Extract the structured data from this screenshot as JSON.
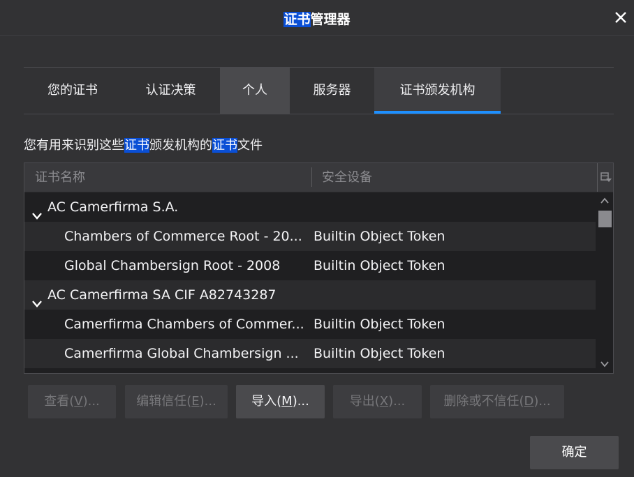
{
  "window": {
    "title_highlight": "证书",
    "title_rest": "管理器",
    "close_label": "×"
  },
  "tabs": [
    {
      "label": "您的证书",
      "selected": false
    },
    {
      "label": "认证决策",
      "selected": false
    },
    {
      "label": "个人",
      "selected": false
    },
    {
      "label": "服务器",
      "selected": false
    },
    {
      "label": "证书颁发机构",
      "selected": true
    }
  ],
  "description": {
    "part1": "您有用来识别这些",
    "hl1": "证书",
    "part2": "颁发机构的",
    "hl2": "证书",
    "part3": "文件"
  },
  "table": {
    "columns": [
      "证书名称",
      "安全设备"
    ],
    "rows": [
      {
        "name": "AC Camerfirma S.A.",
        "device": "",
        "group": true
      },
      {
        "name": "Chambers of Commerce Root - 20...",
        "device": "Builtin Object Token",
        "group": false
      },
      {
        "name": "Global Chambersign Root - 2008",
        "device": "Builtin Object Token",
        "group": false
      },
      {
        "name": "AC Camerfirma SA CIF A82743287",
        "device": "",
        "group": true
      },
      {
        "name": "Camerfirma Chambers of Commer...",
        "device": "Builtin Object Token",
        "group": false
      },
      {
        "name": "Camerfirma Global Chambersign ...",
        "device": "Builtin Object Token",
        "group": false
      }
    ]
  },
  "buttons": {
    "view": {
      "pre": "查看(",
      "key": "V",
      "post": ")..."
    },
    "edit_trust": {
      "pre": "编辑信任(",
      "key": "E",
      "post": ")..."
    },
    "import": {
      "pre": "导入(",
      "key": "M",
      "post": ")..."
    },
    "export": {
      "pre": "导出(",
      "key": "X",
      "post": ")..."
    },
    "delete": {
      "pre": "删除或不信任(",
      "key": "D",
      "post": ")..."
    },
    "ok": "确定"
  },
  "colors": {
    "accent": "#1e90ff",
    "highlight": "#0a4fd6",
    "background": "#323234"
  }
}
